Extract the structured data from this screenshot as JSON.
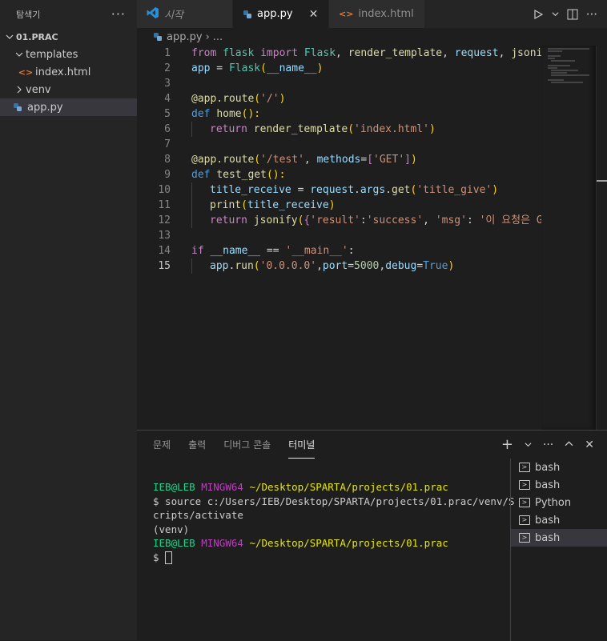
{
  "explorer": {
    "title": "탐색기",
    "root": "01.PRAC",
    "items": [
      {
        "label": "templates"
      },
      {
        "label": "index.html"
      },
      {
        "label": "venv"
      },
      {
        "label": "app.py"
      }
    ]
  },
  "tabs": [
    {
      "label": "시작"
    },
    {
      "label": "app.py"
    },
    {
      "label": "index.html"
    }
  ],
  "breadcrumb": {
    "file": "app.py",
    "rest": "..."
  },
  "code": {
    "l1": [
      "from",
      " flask ",
      "import",
      " Flask",
      ", ",
      "render_template",
      ", ",
      "request",
      ", ",
      "jsonify"
    ],
    "l2": [
      "app",
      " = ",
      "Flask",
      "(",
      "__name__",
      ")"
    ],
    "l4": [
      "@app.route",
      "(",
      "'/'",
      ")"
    ],
    "l5": [
      "def",
      " ",
      "home",
      "():"
    ],
    "l6": [
      "return",
      " ",
      "render_template",
      "(",
      "'index.html'",
      ")"
    ],
    "l8": [
      "@app.route",
      "(",
      "'/test'",
      ", ",
      "methods",
      "=",
      "[",
      "'GET'",
      "]",
      ")"
    ],
    "l9": [
      "def",
      " ",
      "test_get",
      "():"
    ],
    "l10": [
      "title_receive",
      " = ",
      "request",
      ".",
      "args",
      ".",
      "get",
      "(",
      "'title_give'",
      ")"
    ],
    "l11": [
      "print",
      "(",
      "title_receive",
      ")"
    ],
    "l12": [
      "return",
      " ",
      "jsonify",
      "(",
      "{",
      "'result'",
      ":",
      "'success'",
      ", ",
      "'msg'",
      ": ",
      "'이 요청은 GET!'"
    ],
    "l14": [
      "if",
      " ",
      "__name__",
      " == ",
      "'__main__'",
      ":"
    ],
    "l15": [
      "app",
      ".",
      "run",
      "(",
      "'0.0.0.0'",
      ",",
      "port",
      "=",
      "5000",
      ",",
      "debug",
      "=",
      "True",
      ")"
    ]
  },
  "panel": {
    "tabs": [
      "문제",
      "출력",
      "디버그 콘솔",
      "터미널"
    ],
    "plus": "+"
  },
  "terminal": {
    "user": "IEB@LEB",
    "host": "MINGW64",
    "path": "~/Desktop/SPARTA/projects/01.prac",
    "cmd1": "$ source c:/Users/IEB/Desktop/SPARTA/projects/01.prac/venv/S",
    "cmd1b": "cripts/activate",
    "venv": "(venv)",
    "prompt": "$ "
  },
  "terminals": [
    "bash",
    "bash",
    "Python",
    "bash",
    "bash"
  ]
}
